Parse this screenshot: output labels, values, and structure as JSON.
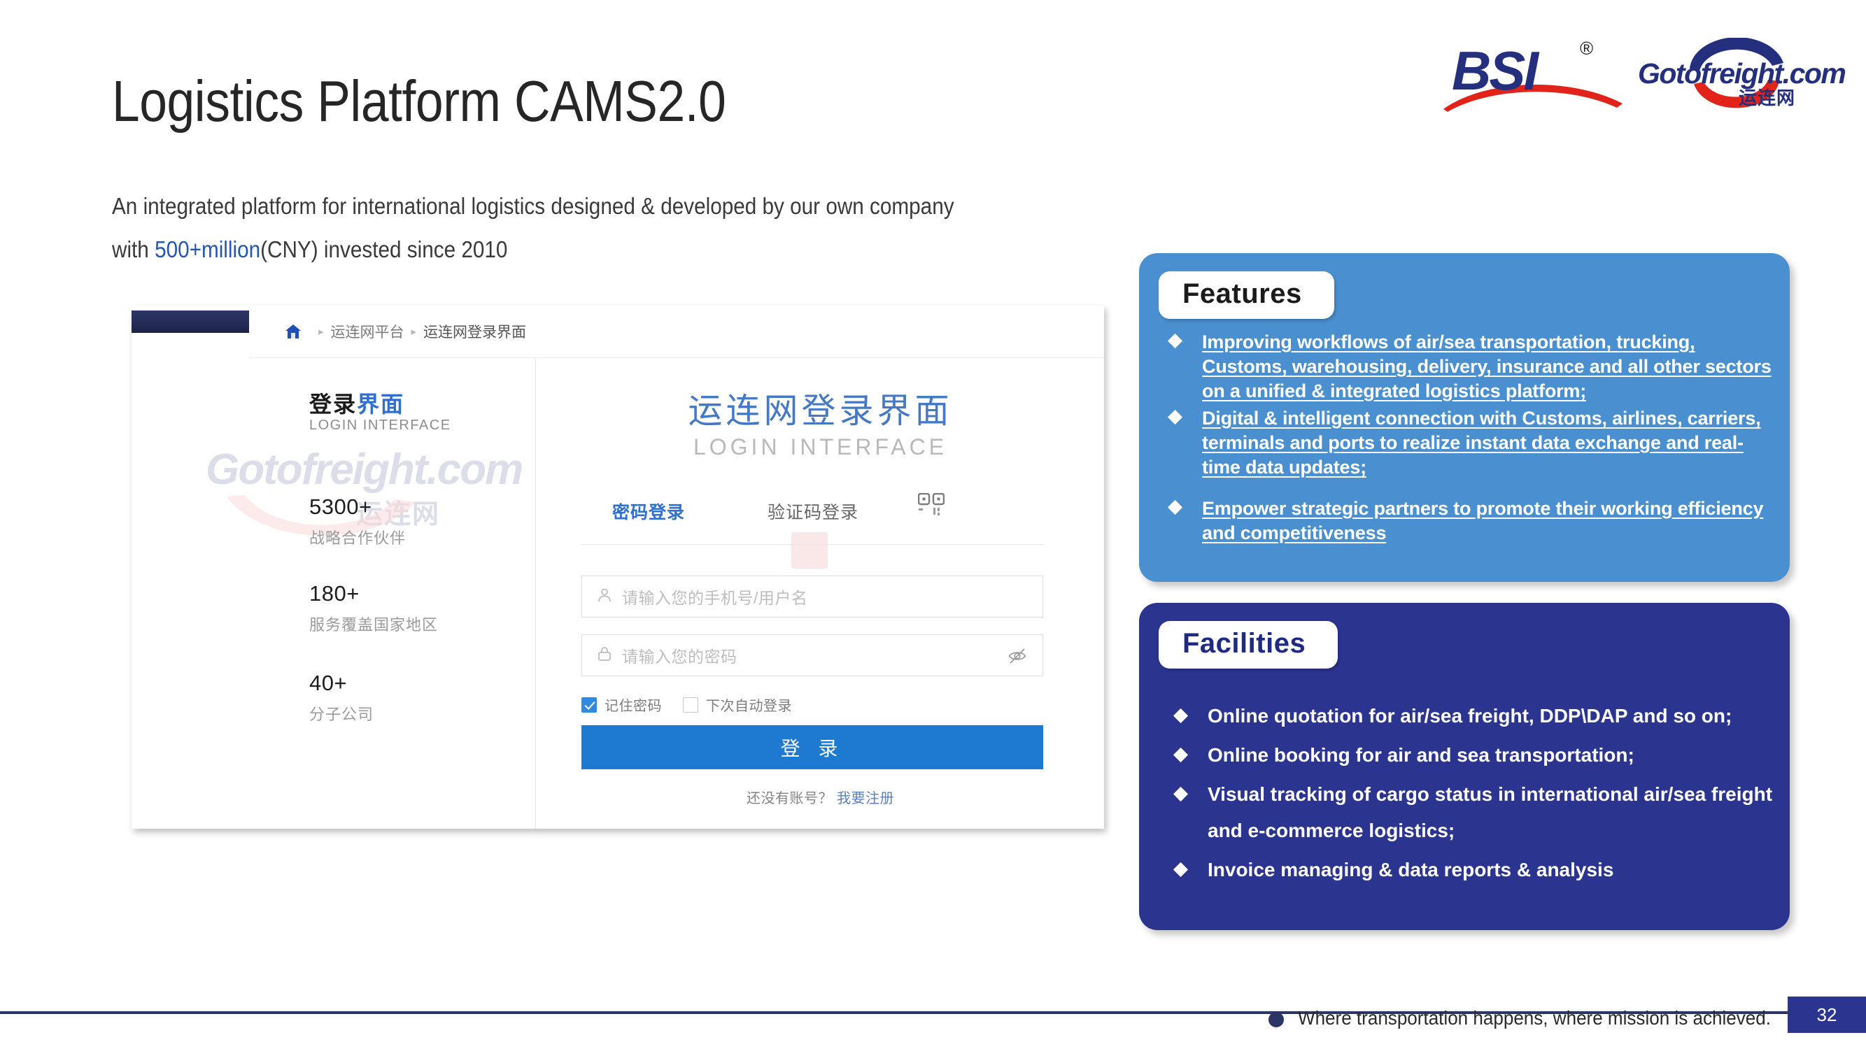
{
  "logo": {
    "bsi_text": "BSI",
    "registered_mark": "®",
    "gotofreight_text": "Gotofreight.com",
    "gotofreight_cn": "运连网"
  },
  "slide": {
    "title": "Logistics Platform CAMS2.0",
    "subtitle_part1": "An integrated platform for international logistics designed & developed by our own company with ",
    "subtitle_highlight": "500+million",
    "subtitle_part2": "(CNY) invested since 2010"
  },
  "screenshot": {
    "breadcrumb": {
      "home_icon": "home-icon",
      "separator": "▸",
      "items": [
        "运连网平台",
        "运连网登录界面"
      ]
    },
    "watermark": {
      "text": "Gotofreight.com",
      "cn": "运连网"
    },
    "left_panel": {
      "title_bold": "登录",
      "title_blue": "界面",
      "subtitle": "LOGIN INTERFACE",
      "stats": [
        {
          "number": "5300+",
          "label": "战略合作伙伴"
        },
        {
          "number": "180+",
          "label": "服务覆盖国家地区"
        },
        {
          "number": "40+",
          "label": "分子公司"
        }
      ]
    },
    "login": {
      "title": "运连网登录界面",
      "subtitle": "LOGIN INTERFACE",
      "tab_active": "密码登录",
      "tab_inactive": "验证码登录",
      "qr_icon": "qr-code-icon",
      "username_placeholder": "请输入您的手机号/用户名",
      "username_icon": "user-icon",
      "password_placeholder": "请输入您的密码",
      "password_icon": "lock-icon",
      "password_toggle_icon": "eye-off-icon",
      "remember_label": "记住密码",
      "remember_checked": true,
      "autologin_label": "下次自动登录",
      "autologin_checked": false,
      "submit_label": "登 录",
      "register_prompt": "还没有账号？",
      "register_link": "我要注册"
    }
  },
  "features": {
    "heading": "Features",
    "accent_color": "#4a90d0",
    "items": [
      "Improving workflows of air/sea transportation, trucking, Customs, warehousing, delivery, insurance and all other sectors on a unified & integrated logistics platform;",
      "Digital & intelligent connection with Customs, airlines, carriers, terminals and ports to realize instant data exchange and real-time data updates;",
      "Empower strategic partners to promote their working efficiency and competitiveness"
    ]
  },
  "facilities": {
    "heading": "Facilities",
    "accent_color": "#2b3590",
    "items": [
      "Online quotation for air/sea freight, DDP\\DAP and so on;",
      "Online booking for air and sea transportation;",
      "Visual tracking of cargo status in international air/sea freight and e-commerce logistics;",
      "Invoice managing & data reports & analysis"
    ]
  },
  "footer": {
    "tagline": "Where transportation happens, where mission is achieved.",
    "page_number": "32"
  }
}
